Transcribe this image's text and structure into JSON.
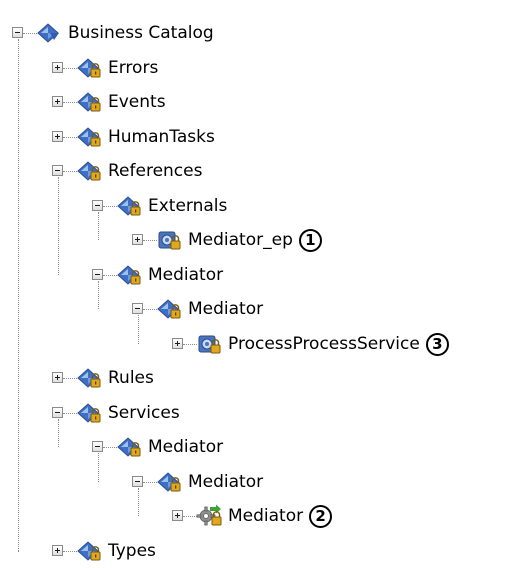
{
  "tree": [
    {
      "label": "Business Catalog",
      "icon": "catalog-folder-icon",
      "state": "expanded"
    },
    {
      "label": "Errors",
      "icon": "locked-folder-icon",
      "state": "collapsed"
    },
    {
      "label": "Events",
      "icon": "locked-folder-icon",
      "state": "collapsed"
    },
    {
      "label": "HumanTasks",
      "icon": "locked-folder-icon",
      "state": "collapsed"
    },
    {
      "label": "References",
      "icon": "locked-folder-icon",
      "state": "expanded"
    },
    {
      "label": "Externals",
      "icon": "locked-folder-icon",
      "state": "expanded"
    },
    {
      "label": "Mediator_ep",
      "icon": "web-service-icon",
      "state": "collapsed",
      "callout": "1"
    },
    {
      "label": "Mediator",
      "icon": "locked-folder-icon",
      "state": "expanded"
    },
    {
      "label": "Mediator",
      "icon": "locked-folder-icon",
      "state": "expanded"
    },
    {
      "label": "ProcessProcessService",
      "icon": "web-service-icon",
      "state": "collapsed",
      "callout": "3"
    },
    {
      "label": "Rules",
      "icon": "locked-folder-icon",
      "state": "collapsed"
    },
    {
      "label": "Services",
      "icon": "locked-folder-icon",
      "state": "expanded"
    },
    {
      "label": "Mediator",
      "icon": "locked-folder-icon",
      "state": "expanded"
    },
    {
      "label": "Mediator",
      "icon": "locked-folder-icon",
      "state": "expanded"
    },
    {
      "label": "Mediator",
      "icon": "mediator-gear-icon",
      "state": "collapsed",
      "callout": "2"
    },
    {
      "label": "Types",
      "icon": "locked-folder-icon",
      "state": "collapsed"
    }
  ],
  "colors": {
    "diamond_fill": "#3f6fc4",
    "diamond_light": "#9dc2f0",
    "lock_gold": "#e0a81c",
    "service_blue": "#4a74bf",
    "gear_gray": "#8f8f8f",
    "arrow_green": "#3aa533",
    "connector": "#8c8c8c",
    "callout_border": "#000000"
  }
}
